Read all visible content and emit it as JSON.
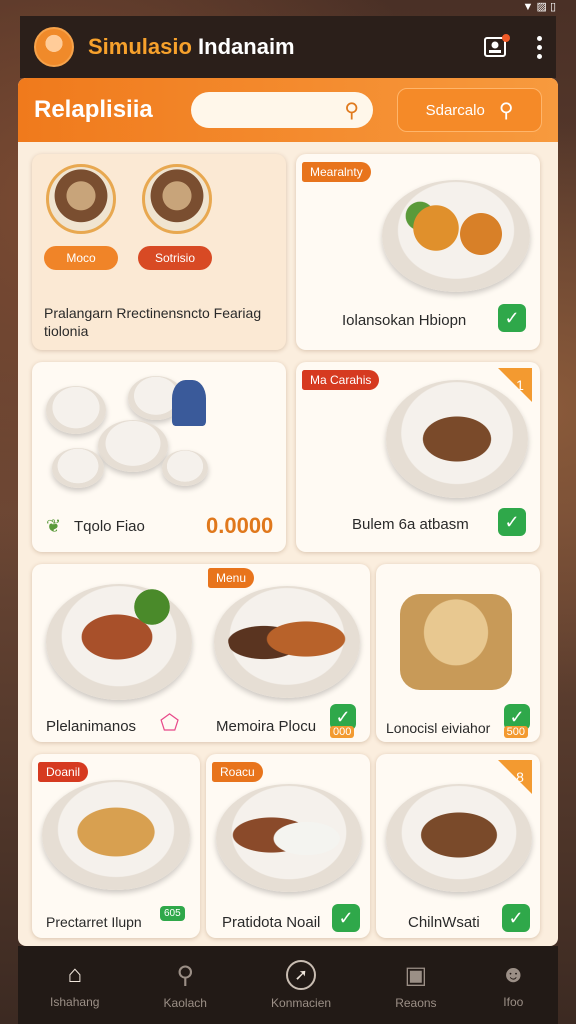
{
  "status": {
    "icons": "▼ ▨ ▯"
  },
  "app": {
    "title_accent": "Simulasio",
    "title_rest": "Indanaim"
  },
  "header": {
    "title": "Relaplisiia",
    "search_button": "Sdarcalo"
  },
  "cards": {
    "c1": {
      "pill_left": "Moco",
      "pill_right": "Sotrisio",
      "caption": "Pralangarn Rrectinensncto Feariag tiolonia"
    },
    "c2": {
      "badge": "Mearalnty",
      "label": "Iolansokan Hbiopn"
    },
    "c3": {
      "label": "Tqolo Fiao",
      "price": "0.0000"
    },
    "c4": {
      "badge": "Ma Carahis",
      "corner": "1",
      "label": "Bulem 6a atbasm"
    },
    "c5": {
      "label": "Plelanimanos"
    },
    "c6": {
      "badge": "Menu",
      "label": "Memoira Plocu",
      "price_tag": "000"
    },
    "c7": {
      "label": "Lonocisl eiviahor",
      "price_tag": "500"
    },
    "c8": {
      "badge": "Doanil",
      "label": "Prectarret Ilupn",
      "price_tag": "605"
    },
    "c9": {
      "badge": "Roacu",
      "label": "Pratidota Noail"
    },
    "c10": {
      "corner": "8",
      "label": "ChilnWsati"
    }
  },
  "nav": [
    {
      "label": "Ishahang",
      "icon": "home-icon"
    },
    {
      "label": "Kaolach",
      "icon": "search-icon"
    },
    {
      "label": "Konmacien",
      "icon": "compass-icon"
    },
    {
      "label": "Reaons",
      "icon": "bag-icon"
    },
    {
      "label": "Ifoo",
      "icon": "profile-icon"
    }
  ],
  "colors": {
    "accent": "#f07a1c",
    "check": "#2fa84a",
    "badge_red": "#d63a20"
  }
}
